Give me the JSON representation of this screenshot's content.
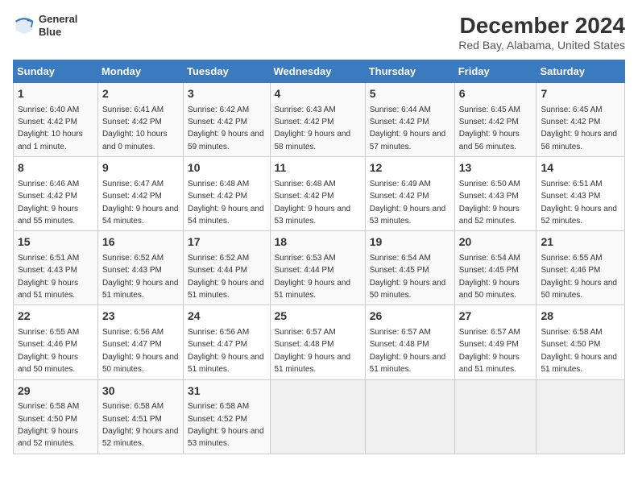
{
  "header": {
    "logo_line1": "General",
    "logo_line2": "Blue",
    "title": "December 2024",
    "subtitle": "Red Bay, Alabama, United States"
  },
  "days_of_week": [
    "Sunday",
    "Monday",
    "Tuesday",
    "Wednesday",
    "Thursday",
    "Friday",
    "Saturday"
  ],
  "weeks": [
    [
      {
        "day": "1",
        "sunrise": "Sunrise: 6:40 AM",
        "sunset": "Sunset: 4:42 PM",
        "daylight": "Daylight: 10 hours and 1 minute."
      },
      {
        "day": "2",
        "sunrise": "Sunrise: 6:41 AM",
        "sunset": "Sunset: 4:42 PM",
        "daylight": "Daylight: 10 hours and 0 minutes."
      },
      {
        "day": "3",
        "sunrise": "Sunrise: 6:42 AM",
        "sunset": "Sunset: 4:42 PM",
        "daylight": "Daylight: 9 hours and 59 minutes."
      },
      {
        "day": "4",
        "sunrise": "Sunrise: 6:43 AM",
        "sunset": "Sunset: 4:42 PM",
        "daylight": "Daylight: 9 hours and 58 minutes."
      },
      {
        "day": "5",
        "sunrise": "Sunrise: 6:44 AM",
        "sunset": "Sunset: 4:42 PM",
        "daylight": "Daylight: 9 hours and 57 minutes."
      },
      {
        "day": "6",
        "sunrise": "Sunrise: 6:45 AM",
        "sunset": "Sunset: 4:42 PM",
        "daylight": "Daylight: 9 hours and 56 minutes."
      },
      {
        "day": "7",
        "sunrise": "Sunrise: 6:45 AM",
        "sunset": "Sunset: 4:42 PM",
        "daylight": "Daylight: 9 hours and 56 minutes."
      }
    ],
    [
      {
        "day": "8",
        "sunrise": "Sunrise: 6:46 AM",
        "sunset": "Sunset: 4:42 PM",
        "daylight": "Daylight: 9 hours and 55 minutes."
      },
      {
        "day": "9",
        "sunrise": "Sunrise: 6:47 AM",
        "sunset": "Sunset: 4:42 PM",
        "daylight": "Daylight: 9 hours and 54 minutes."
      },
      {
        "day": "10",
        "sunrise": "Sunrise: 6:48 AM",
        "sunset": "Sunset: 4:42 PM",
        "daylight": "Daylight: 9 hours and 54 minutes."
      },
      {
        "day": "11",
        "sunrise": "Sunrise: 6:48 AM",
        "sunset": "Sunset: 4:42 PM",
        "daylight": "Daylight: 9 hours and 53 minutes."
      },
      {
        "day": "12",
        "sunrise": "Sunrise: 6:49 AM",
        "sunset": "Sunset: 4:42 PM",
        "daylight": "Daylight: 9 hours and 53 minutes."
      },
      {
        "day": "13",
        "sunrise": "Sunrise: 6:50 AM",
        "sunset": "Sunset: 4:43 PM",
        "daylight": "Daylight: 9 hours and 52 minutes."
      },
      {
        "day": "14",
        "sunrise": "Sunrise: 6:51 AM",
        "sunset": "Sunset: 4:43 PM",
        "daylight": "Daylight: 9 hours and 52 minutes."
      }
    ],
    [
      {
        "day": "15",
        "sunrise": "Sunrise: 6:51 AM",
        "sunset": "Sunset: 4:43 PM",
        "daylight": "Daylight: 9 hours and 51 minutes."
      },
      {
        "day": "16",
        "sunrise": "Sunrise: 6:52 AM",
        "sunset": "Sunset: 4:43 PM",
        "daylight": "Daylight: 9 hours and 51 minutes."
      },
      {
        "day": "17",
        "sunrise": "Sunrise: 6:52 AM",
        "sunset": "Sunset: 4:44 PM",
        "daylight": "Daylight: 9 hours and 51 minutes."
      },
      {
        "day": "18",
        "sunrise": "Sunrise: 6:53 AM",
        "sunset": "Sunset: 4:44 PM",
        "daylight": "Daylight: 9 hours and 51 minutes."
      },
      {
        "day": "19",
        "sunrise": "Sunrise: 6:54 AM",
        "sunset": "Sunset: 4:45 PM",
        "daylight": "Daylight: 9 hours and 50 minutes."
      },
      {
        "day": "20",
        "sunrise": "Sunrise: 6:54 AM",
        "sunset": "Sunset: 4:45 PM",
        "daylight": "Daylight: 9 hours and 50 minutes."
      },
      {
        "day": "21",
        "sunrise": "Sunrise: 6:55 AM",
        "sunset": "Sunset: 4:46 PM",
        "daylight": "Daylight: 9 hours and 50 minutes."
      }
    ],
    [
      {
        "day": "22",
        "sunrise": "Sunrise: 6:55 AM",
        "sunset": "Sunset: 4:46 PM",
        "daylight": "Daylight: 9 hours and 50 minutes."
      },
      {
        "day": "23",
        "sunrise": "Sunrise: 6:56 AM",
        "sunset": "Sunset: 4:47 PM",
        "daylight": "Daylight: 9 hours and 50 minutes."
      },
      {
        "day": "24",
        "sunrise": "Sunrise: 6:56 AM",
        "sunset": "Sunset: 4:47 PM",
        "daylight": "Daylight: 9 hours and 51 minutes."
      },
      {
        "day": "25",
        "sunrise": "Sunrise: 6:57 AM",
        "sunset": "Sunset: 4:48 PM",
        "daylight": "Daylight: 9 hours and 51 minutes."
      },
      {
        "day": "26",
        "sunrise": "Sunrise: 6:57 AM",
        "sunset": "Sunset: 4:48 PM",
        "daylight": "Daylight: 9 hours and 51 minutes."
      },
      {
        "day": "27",
        "sunrise": "Sunrise: 6:57 AM",
        "sunset": "Sunset: 4:49 PM",
        "daylight": "Daylight: 9 hours and 51 minutes."
      },
      {
        "day": "28",
        "sunrise": "Sunrise: 6:58 AM",
        "sunset": "Sunset: 4:50 PM",
        "daylight": "Daylight: 9 hours and 51 minutes."
      }
    ],
    [
      {
        "day": "29",
        "sunrise": "Sunrise: 6:58 AM",
        "sunset": "Sunset: 4:50 PM",
        "daylight": "Daylight: 9 hours and 52 minutes."
      },
      {
        "day": "30",
        "sunrise": "Sunrise: 6:58 AM",
        "sunset": "Sunset: 4:51 PM",
        "daylight": "Daylight: 9 hours and 52 minutes."
      },
      {
        "day": "31",
        "sunrise": "Sunrise: 6:58 AM",
        "sunset": "Sunset: 4:52 PM",
        "daylight": "Daylight: 9 hours and 53 minutes."
      },
      null,
      null,
      null,
      null
    ]
  ]
}
